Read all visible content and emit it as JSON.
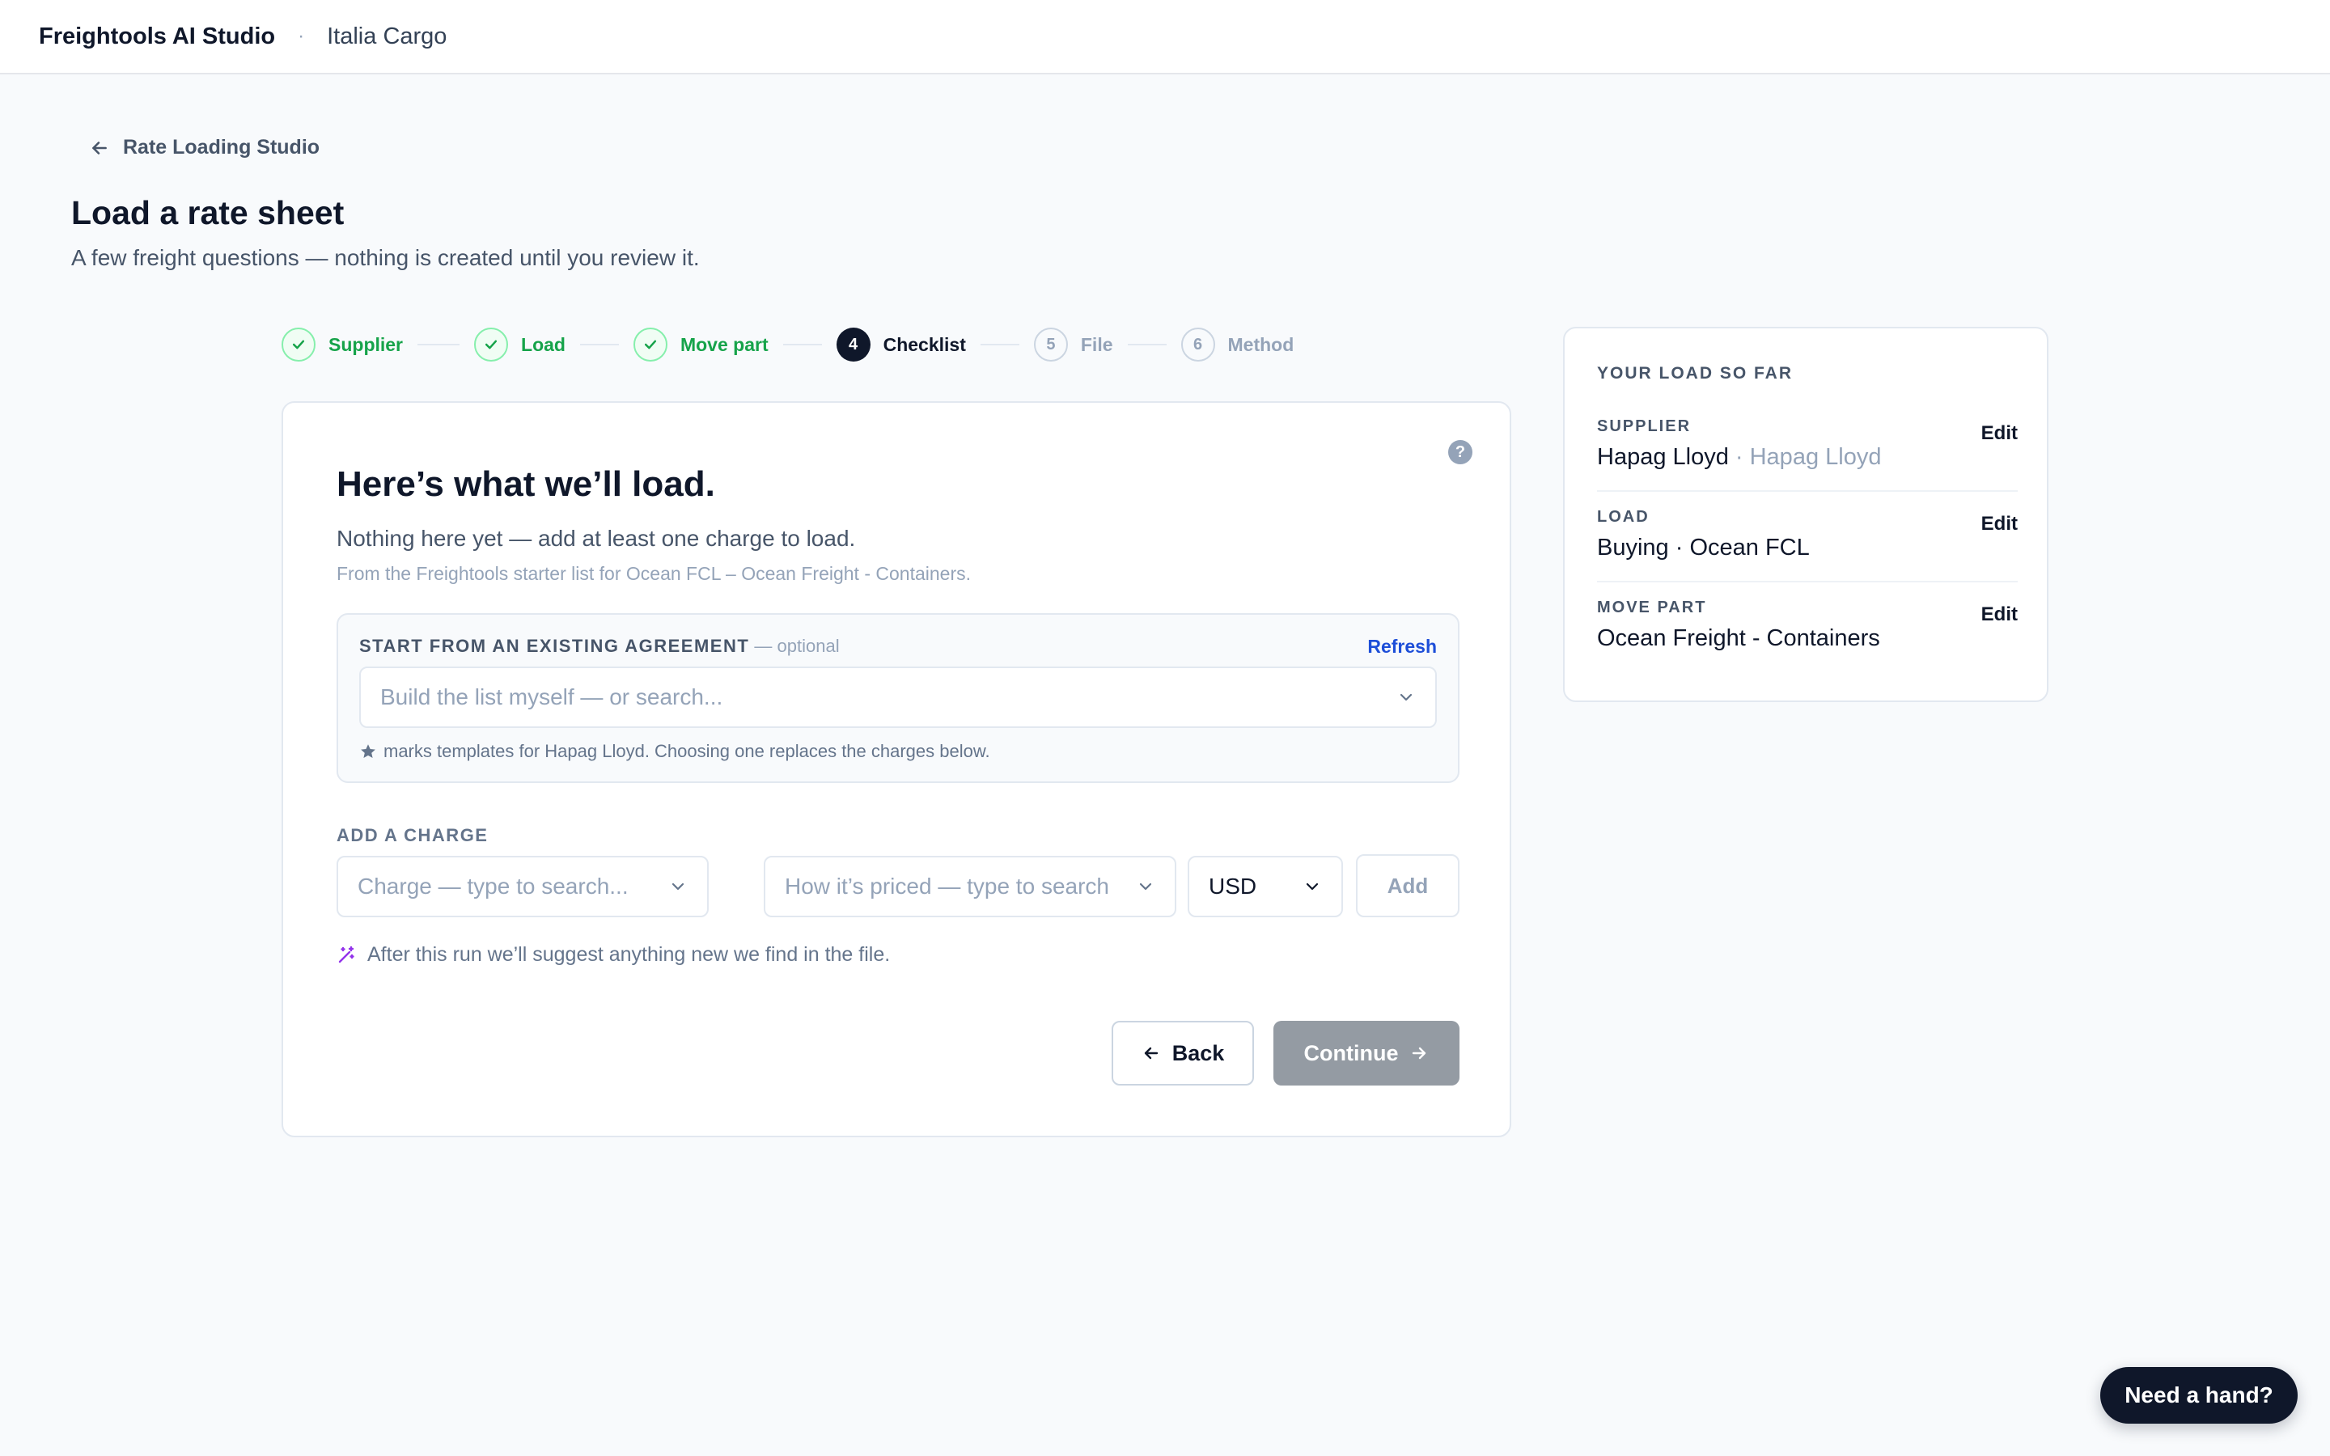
{
  "app": {
    "brand": "Freightools AI Studio",
    "separator": "·",
    "org": "Italia Cargo"
  },
  "nav": {
    "back_label": "Rate Loading Studio"
  },
  "page": {
    "title": "Load a rate sheet",
    "subtitle": "A few freight questions — nothing is created until you review it."
  },
  "stepper": {
    "steps": [
      {
        "num": "1",
        "label": "Supplier",
        "state": "done"
      },
      {
        "num": "2",
        "label": "Load",
        "state": "done"
      },
      {
        "num": "3",
        "label": "Move part",
        "state": "done"
      },
      {
        "num": "4",
        "label": "Checklist",
        "state": "active"
      },
      {
        "num": "5",
        "label": "File",
        "state": "todo"
      },
      {
        "num": "6",
        "label": "Method",
        "state": "todo"
      }
    ]
  },
  "card": {
    "help": "?",
    "title": "Here’s what we’ll load.",
    "subtitle": "Nothing here yet — add at least one charge to load.",
    "note": "From the Freightools starter list for Ocean FCL – Ocean Freight - Containers."
  },
  "agreement": {
    "label": "START FROM AN EXISTING AGREEMENT",
    "optional": " — optional",
    "refresh": "Refresh",
    "placeholder": "Build the list myself — or search...",
    "hint": "marks templates for Hapag Lloyd. Choosing one replaces the charges below."
  },
  "charge": {
    "label": "ADD A CHARGE",
    "charge_placeholder": "Charge — type to search...",
    "priced_placeholder": "How it’s priced — type to search...",
    "currency": "USD",
    "add": "Add",
    "suggest": "After this run we’ll suggest anything new we find in the file."
  },
  "actions": {
    "back": "Back",
    "continue": "Continue"
  },
  "summary": {
    "heading": "YOUR LOAD SO FAR",
    "edit": "Edit",
    "rows": [
      {
        "key": "SUPPLIER",
        "value": "Hapag Lloyd",
        "muted": " · Hapag Lloyd"
      },
      {
        "key": "LOAD",
        "value": "Buying · Ocean FCL",
        "muted": ""
      },
      {
        "key": "MOVE PART",
        "value": "Ocean Freight - Containers",
        "muted": ""
      }
    ]
  },
  "help_bubble": "Need a hand?",
  "colors": {
    "success": "#16a34a",
    "primary": "#0f172a",
    "link": "#1d4ed8",
    "accent": "#9333ea",
    "disabled": "#949ba3"
  }
}
